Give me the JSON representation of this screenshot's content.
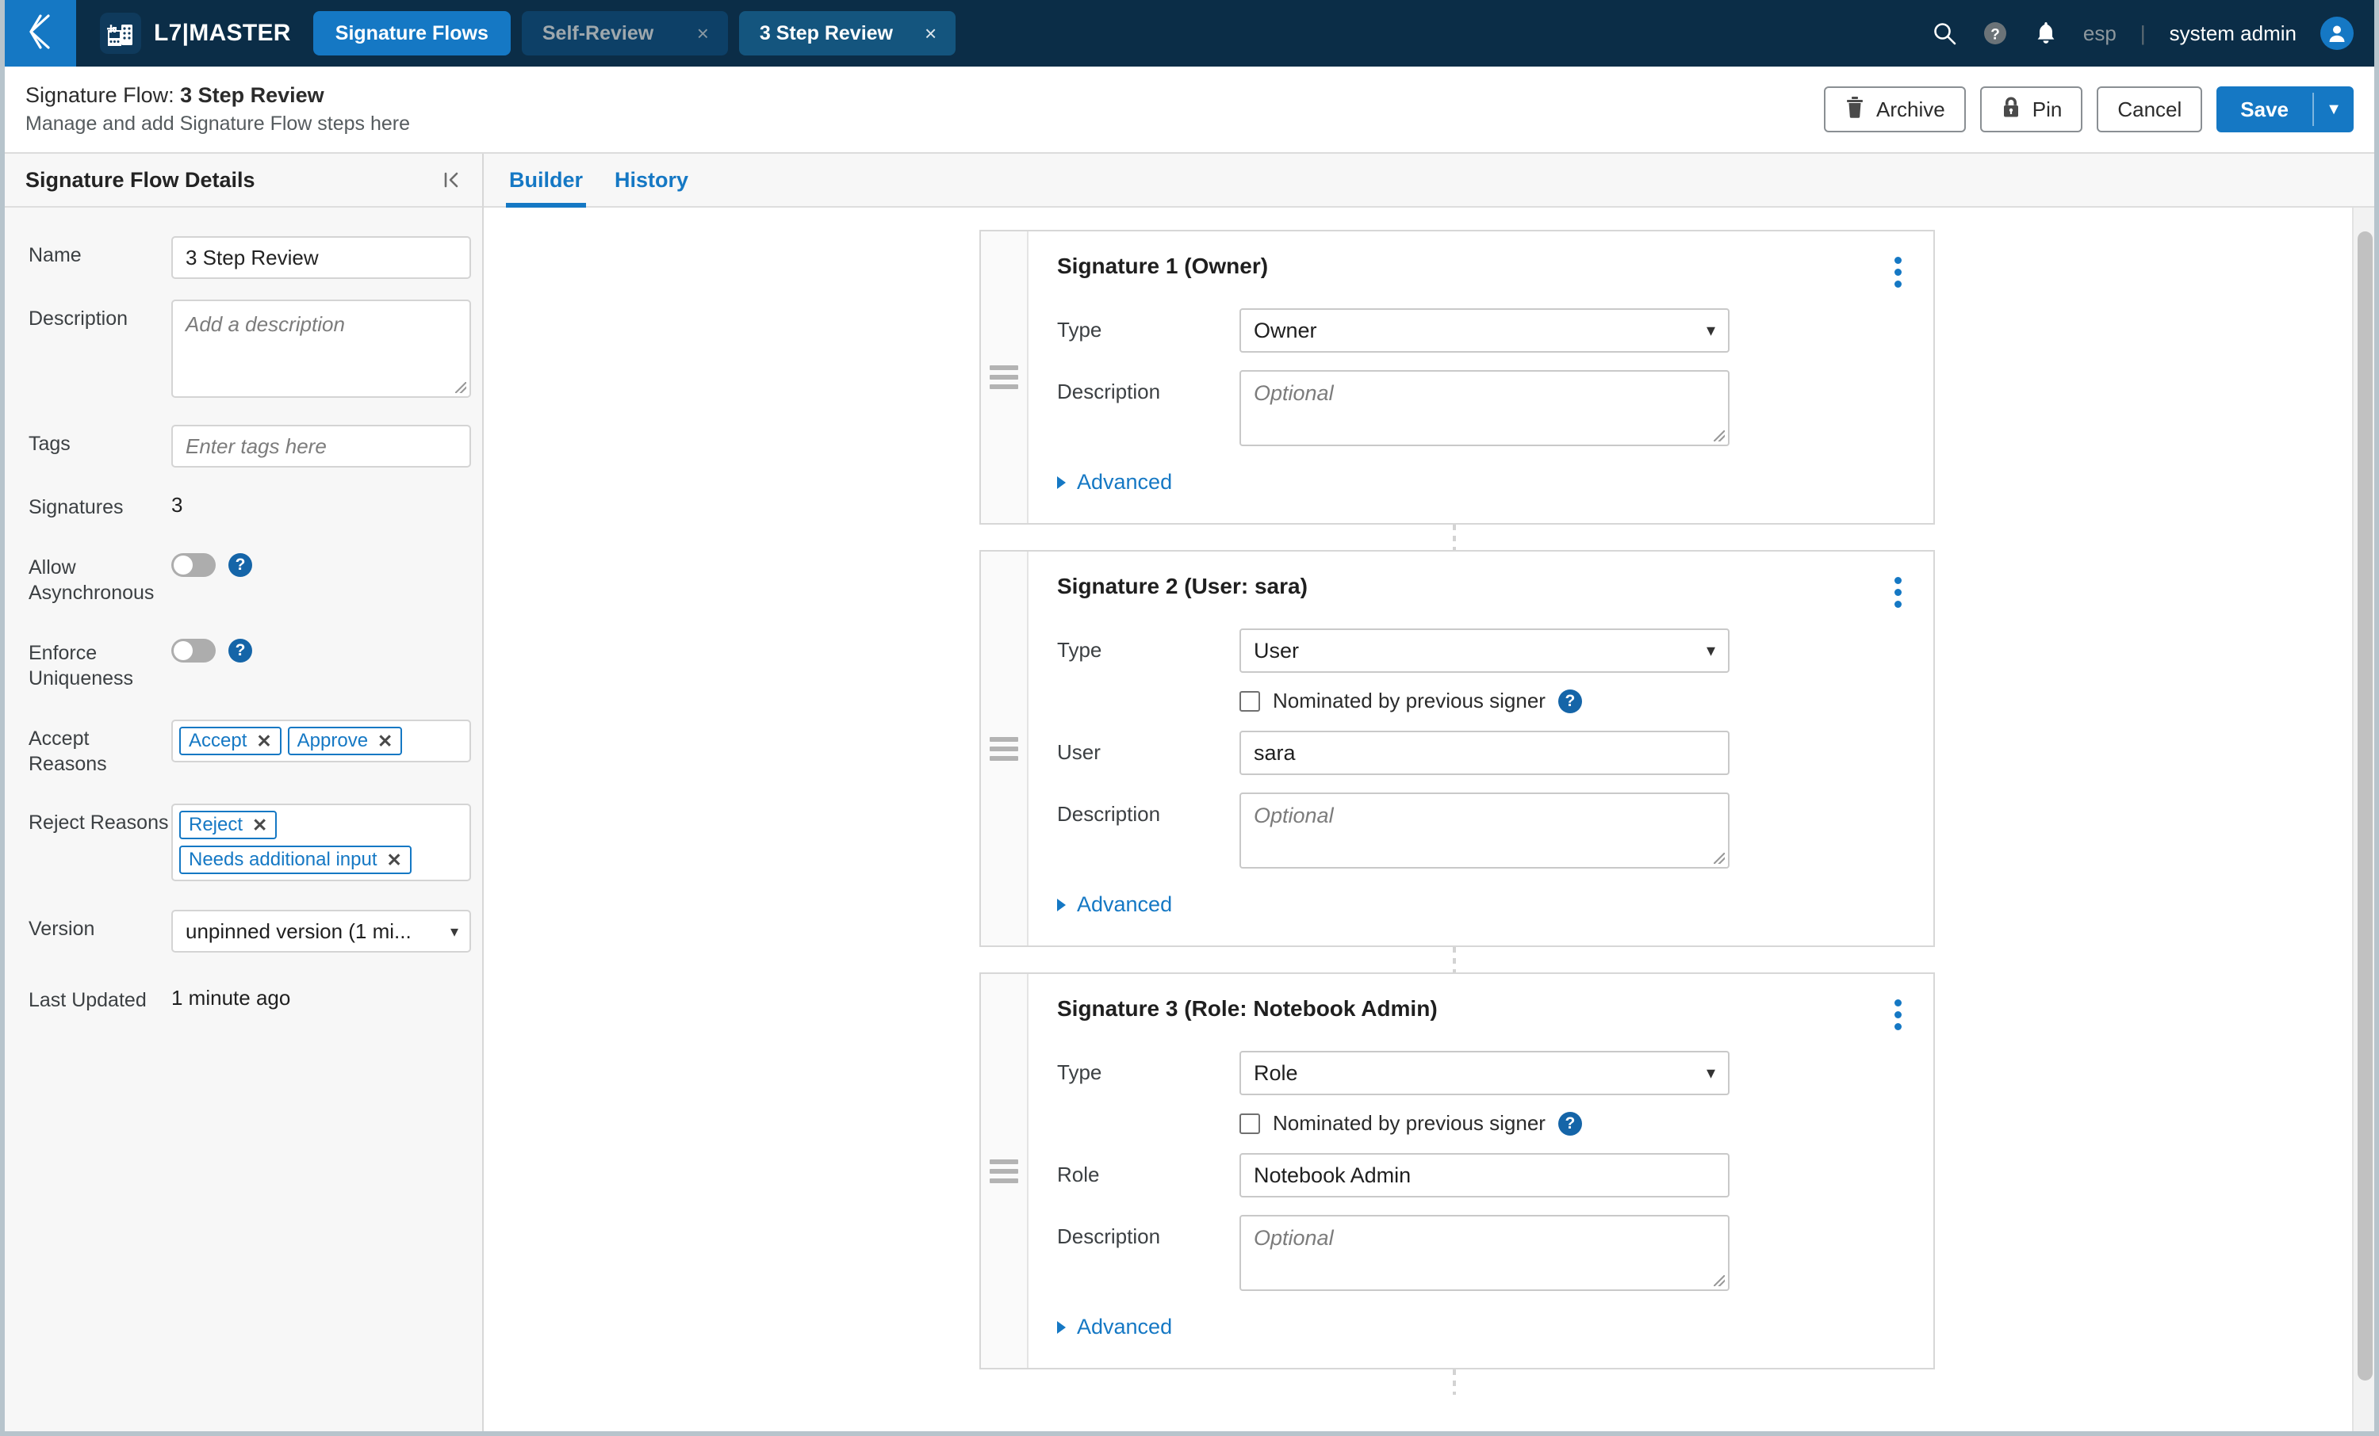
{
  "topnav": {
    "back_icon": "chevron-left-icon",
    "brand": "L7|MASTER",
    "brand_logo_icon": "building-plus-icon",
    "active_pill": "Signature Flows",
    "tabs": [
      {
        "label": "Self-Review",
        "active": false,
        "close": "×"
      },
      {
        "label": "3 Step Review",
        "active": true,
        "close": "×"
      }
    ],
    "search_icon": "search-icon",
    "help_icon": "question-circle-icon",
    "bell_icon": "bell-icon",
    "language": "esp",
    "separator": "|",
    "username": "system admin",
    "avatar_icon": "user-avatar-icon"
  },
  "page_header": {
    "title_prefix": "Signature Flow: ",
    "title_name": "3 Step Review",
    "subtitle": "Manage and add Signature Flow steps here",
    "archive_label": "Archive",
    "archive_icon": "trash-icon",
    "pin_label": "Pin",
    "pin_icon": "lock-icon",
    "cancel_label": "Cancel",
    "save_label": "Save",
    "save_caret_icon": "chevron-down-icon"
  },
  "sidebar": {
    "title": "Signature Flow Details",
    "collapse_icon": "collapse-panel-left-icon",
    "name_label": "Name",
    "name_value": "3 Step Review",
    "description_label": "Description",
    "description_placeholder": "Add a description",
    "tags_label": "Tags",
    "tags_placeholder": "Enter tags here",
    "signatures_label": "Signatures",
    "signatures_value": "3",
    "allow_async_label": "Allow Asynchronous",
    "allow_async_on": false,
    "allow_async_help_icon": "help-icon",
    "enforce_unique_label": "Enforce Uniqueness",
    "enforce_unique_on": false,
    "enforce_unique_help_icon": "help-icon",
    "accept_reasons_label": "Accept Reasons",
    "accept_reasons": [
      "Accept",
      "Approve"
    ],
    "reject_reasons_label": "Reject Reasons",
    "reject_reasons": [
      "Reject",
      "Needs additional input"
    ],
    "chip_remove_icon": "✕",
    "version_label": "Version",
    "version_value": "unpinned version (1 mi...",
    "version_caret_icon": "chevron-down-icon",
    "last_updated_label": "Last Updated",
    "last_updated_value": "1 minute ago"
  },
  "main": {
    "tabs": [
      {
        "label": "Builder",
        "active": true
      },
      {
        "label": "History",
        "active": false
      }
    ],
    "grip_icon": "drag-handle-icon",
    "kebab_icon": "more-vertical-icon",
    "advanced_label": "Advanced",
    "advanced_icon": "triangle-right-icon",
    "type_label": "Type",
    "description_label": "Description",
    "description_placeholder": "Optional",
    "nominated_label": "Nominated by previous signer",
    "nominated_help_icon": "help-icon",
    "select_caret_icon": "chevron-down-icon",
    "cards": [
      {
        "title": "Signature 1 (Owner)",
        "type_value": "Owner",
        "has_nominated": false,
        "nominated_checked": false,
        "extra_label": null,
        "extra_value": null,
        "description_value": ""
      },
      {
        "title": "Signature 2 (User: sara)",
        "type_value": "User",
        "has_nominated": true,
        "nominated_checked": false,
        "extra_label": "User",
        "extra_value": "sara",
        "description_value": ""
      },
      {
        "title": "Signature 3 (Role: Notebook Admin)",
        "type_value": "Role",
        "has_nominated": true,
        "nominated_checked": false,
        "extra_label": "Role",
        "extra_value": "Notebook Admin",
        "description_value": ""
      }
    ]
  },
  "colors": {
    "nav_bg": "#0b2d47",
    "accent": "#1578c4",
    "tab_active_bg": "#14557e",
    "tab_inactive_bg": "#0d4067",
    "sidebar_bg": "#f7f7f7",
    "help_blue": "#1565a8",
    "border": "#d7d7d7"
  }
}
